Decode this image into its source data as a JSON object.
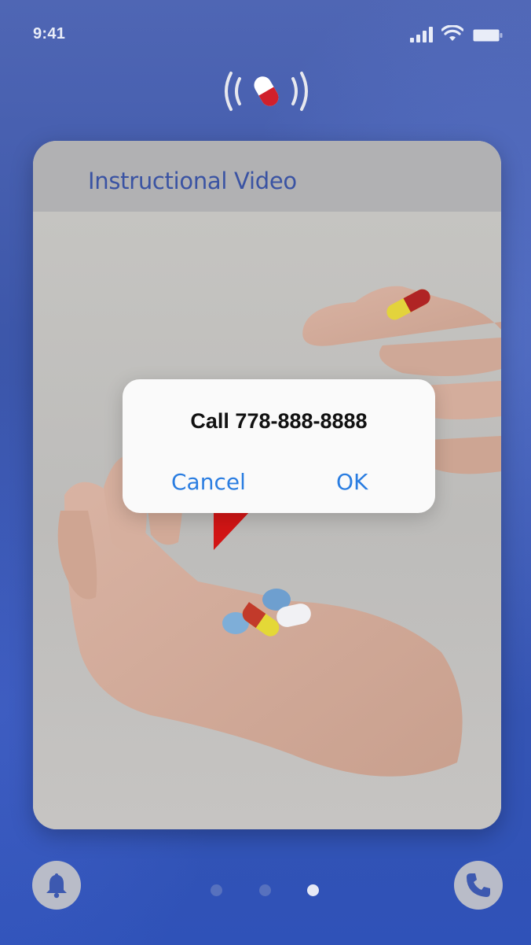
{
  "status_bar": {
    "time": "9:41",
    "icons": [
      "cellular-signal-icon",
      "wifi-icon",
      "battery-icon"
    ]
  },
  "header": {
    "logo_icon": "pill-broadcast-icon"
  },
  "card": {
    "title": "Instructional Video",
    "video_thumbnail": "hands-with-pills-image"
  },
  "dialog": {
    "title": "Call 778-888-8888",
    "cancel_label": "Cancel",
    "ok_label": "OK"
  },
  "bottom_bar": {
    "left_icon": "bell-icon",
    "right_icon": "phone-icon",
    "page_count": 3,
    "active_page": 3
  },
  "colors": {
    "background": "#3553a8",
    "title_blue": "#3a53a3",
    "dialog_button_blue": "#2a7de1",
    "pill_red": "#d0202c"
  }
}
